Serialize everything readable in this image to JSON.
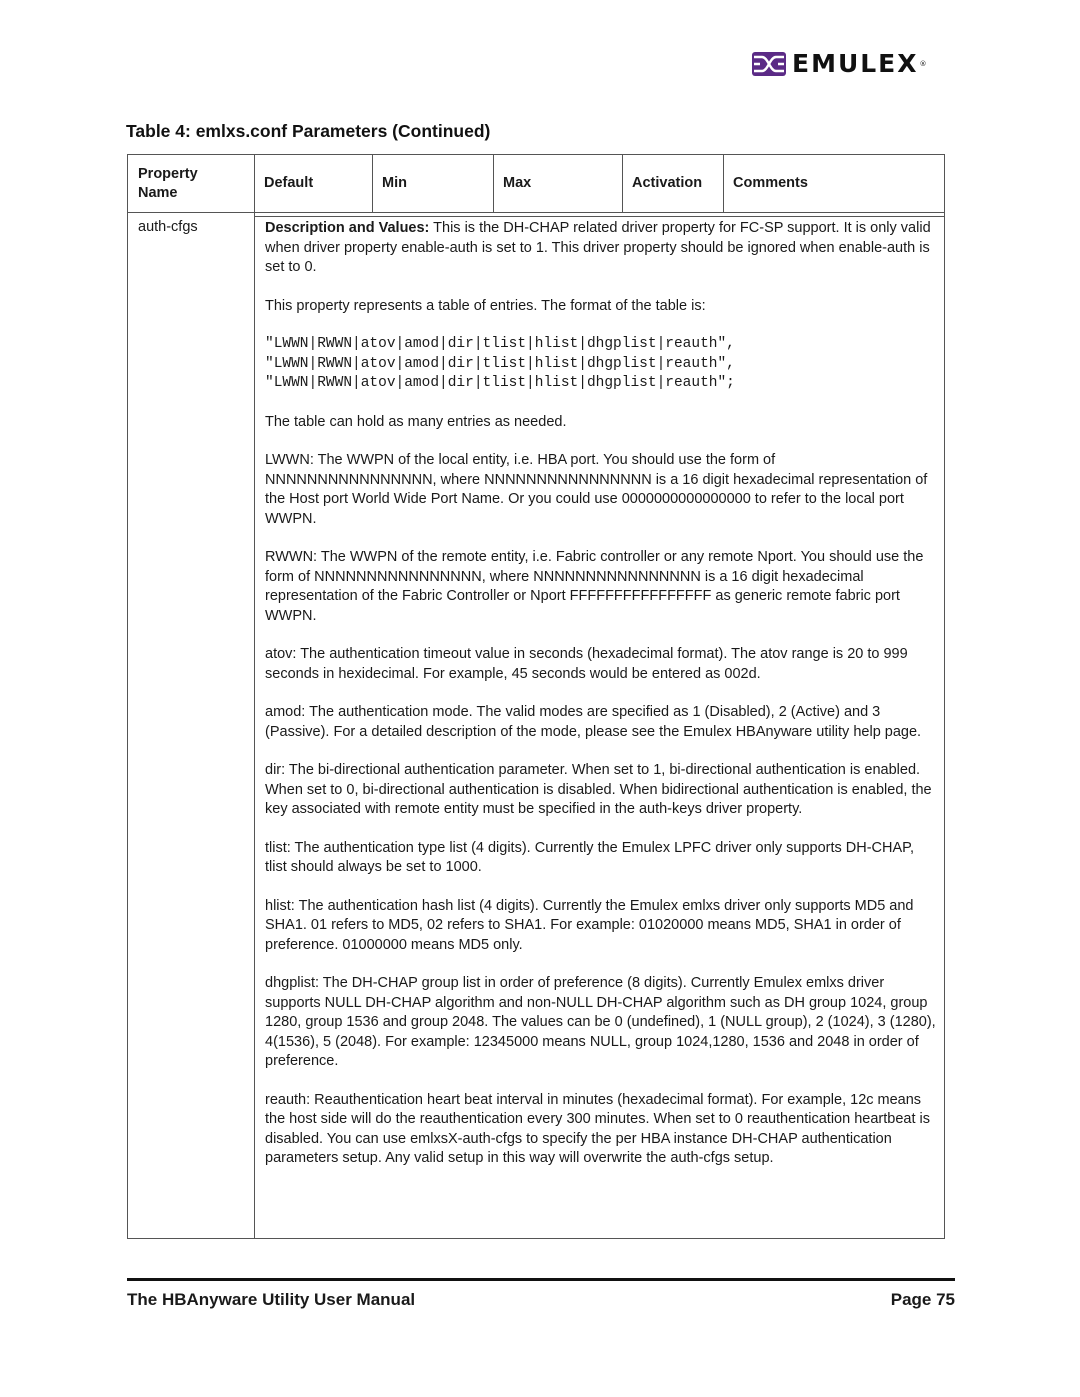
{
  "header": {
    "logo_text": "EMULEX",
    "logo_reg": "®",
    "brand_color": "#5b2a86"
  },
  "table": {
    "title": "Table 4: emlxs.conf Parameters (Continued)",
    "columns": [
      "Property Name",
      "Default",
      "Min",
      "Max",
      "Activation",
      "Comments"
    ],
    "column_lines": {
      "property": "Property",
      "name": "Name"
    },
    "row": {
      "property_name": "auth-cfgs",
      "description_label": "Description and Values:",
      "description_intro": " This is the DH-CHAP related driver property for FC-SP support. It is only valid when driver property enable-auth is set to 1. This driver property should be ignored when enable-auth is set to 0.",
      "format_intro": "This property represents a table of entries. The format of the table is:",
      "format_lines": [
        "\"LWWN|RWWN|atov|amod|dir|tlist|hlist|dhgplist|reauth\",",
        "\"LWWN|RWWN|atov|amod|dir|tlist|hlist|dhgplist|reauth\",",
        "\"LWWN|RWWN|atov|amod|dir|tlist|hlist|dhgplist|reauth\";"
      ],
      "entries_note": "The table can hold as many entries as needed.",
      "paragraphs": [
        "LWWN: The WWPN of the local entity, i.e. HBA port. You should use the form of NNNNNNNNNNNNNNNN, where NNNNNNNNNNNNNNNN is a 16 digit hexadecimal representation of the Host port World Wide Port Name. Or you could use 0000000000000000 to refer to the local port WWPN.",
        "RWWN: The WWPN of the remote entity, i.e. Fabric controller or any remote Nport. You should use the form of NNNNNNNNNNNNNNNN, where NNNNNNNNNNNNNNNN is a 16 digit hexadecimal representation of the Fabric Controller or Nport FFFFFFFFFFFFFFFF as generic remote fabric port WWPN.",
        "atov: The authentication timeout value in seconds (hexadecimal format). The atov range is 20 to 999 seconds in hexidecimal. For example, 45 seconds would be entered as 002d.",
        "amod: The authentication mode. The valid modes are specified as 1 (Disabled), 2 (Active) and 3 (Passive). For a detailed description of the mode, please see the Emulex HBAnyware utility help page.",
        "dir: The bi-directional authentication parameter. When set to 1, bi-directional authentication is enabled. When set to 0, bi-directional authentication is disabled. When bidirectional authentication is enabled, the key associated with remote entity must be specified in the auth-keys driver property.",
        "tlist: The authentication type list (4 digits). Currently the Emulex LPFC driver only supports DH-CHAP, tlist should always be set to 1000.",
        "hlist: The authentication hash list (4 digits). Currently the Emulex emlxs driver only supports MD5 and SHA1. 01 refers to MD5, 02 refers to SHA1. For example: 01020000 means MD5, SHA1 in order of preference. 01000000 means MD5 only.",
        "dhgplist: The DH-CHAP group list in order of preference (8 digits). Currently Emulex emlxs driver supports NULL DH-CHAP algorithm and non-NULL DH-CHAP algorithm such as DH group 1024, group 1280, group 1536 and group 2048. The values can be 0 (undefined), 1 (NULL group), 2 (1024), 3 (1280), 4(1536), 5 (2048). For example: 12345000 means NULL, group 1024,1280, 1536 and 2048 in order of preference.",
        "reauth: Reauthentication heart beat interval in minutes (hexadecimal format). For example, 12c means the host side will do the reauthentication every 300 minutes. When set to 0 reauthentication heartbeat is disabled. You can use emlxsX-auth-cfgs to specify the per HBA instance DH-CHAP authentication parameters setup. Any valid setup in this way will overwrite the auth-cfgs setup."
      ]
    }
  },
  "footer": {
    "manual_title": "The HBAnyware Utility User Manual",
    "page_label": "Page 75"
  }
}
